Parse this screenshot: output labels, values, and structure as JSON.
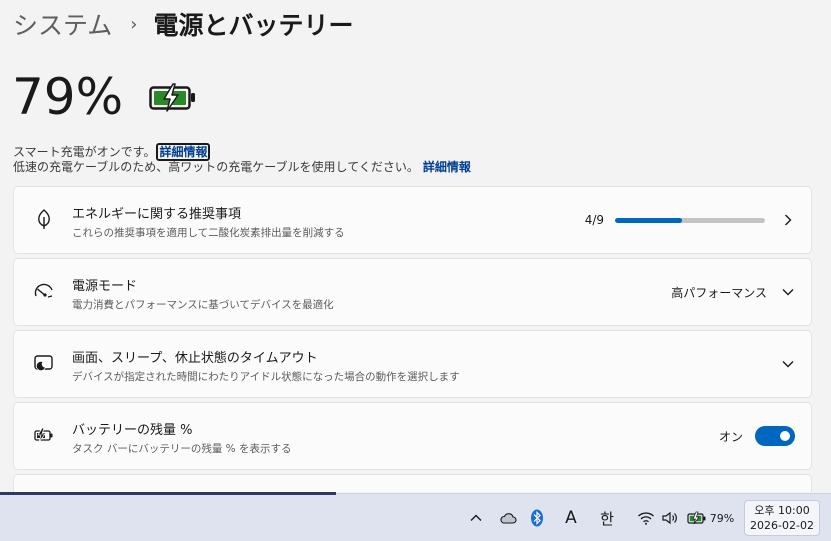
{
  "breadcrumb": {
    "parent": "システム",
    "separator": "›",
    "current": "電源とバッテリー"
  },
  "battery": {
    "percent": "79%",
    "level": 0.79
  },
  "notes": {
    "smart_charging": "スマート充電がオンです。",
    "smart_link": "詳細情報",
    "slow_charger": "低速の充電ケーブルのため、高ワットの充電ケーブルを使用してください。",
    "slow_link": "詳細情報"
  },
  "cards": {
    "energy": {
      "title": "エネルギーに関する推奨事項",
      "subtitle": "これらの推奨事項を適用して二酸化炭素排出量を削減する",
      "progress_label": "4/9",
      "progress": 0.444
    },
    "power_mode": {
      "title": "電源モード",
      "subtitle": "電力消費とパフォーマンスに基づいてデバイスを最適化",
      "value": "高パフォーマンス"
    },
    "timeout": {
      "title": "画面、スリープ、休止状態のタイムアウト",
      "subtitle": "デバイスが指定された時間にわたりアイドル状態になった場合の動作を選択します"
    },
    "battery_percent": {
      "title": "バッテリーの残量 %",
      "subtitle": "タスク バーにバッテリーの残量 % を表示する",
      "toggle_label": "オン",
      "toggle_on": true
    }
  },
  "taskbar": {
    "ime_mode": "A",
    "ime_lang": "한",
    "battery_percent": "79%",
    "clock_time": "오후 10:00",
    "clock_date": "2026-02-02"
  },
  "colors": {
    "accent": "#0067c0",
    "battery_green": "#2a8a2a",
    "link": "#003e92"
  }
}
